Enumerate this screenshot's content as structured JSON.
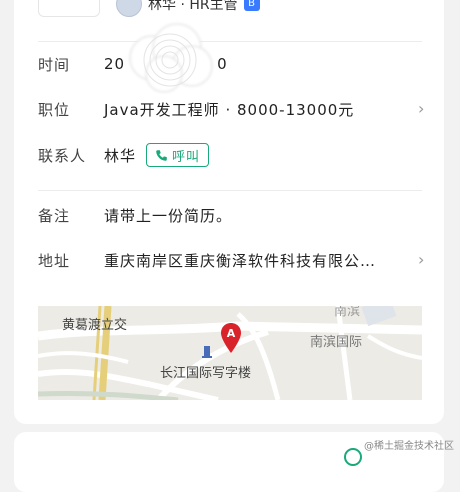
{
  "header": {
    "hr_name": "林华 · HR主管",
    "hr_badge": "B"
  },
  "details": {
    "time": {
      "label": "时间",
      "value_prefix": "20",
      "value_suffix": "0"
    },
    "position": {
      "label": "职位",
      "value": "Java开发工程师 · 8000-13000元"
    },
    "contact": {
      "label": "联系人",
      "value": "林华",
      "call_label": "呼叫"
    },
    "note": {
      "label": "备注",
      "value": "请带上一份简历。"
    },
    "address": {
      "label": "地址",
      "value": "重庆南岸区重庆衡泽软件科技有限公…"
    }
  },
  "map": {
    "labels": {
      "top_left": "黄葛渡立交",
      "right": "南滨国际",
      "building": "长江国际写字楼",
      "top_right": "南滨",
      "marker": "A"
    }
  },
  "footer": {
    "watermark": "@稀土掘金技术社区"
  },
  "colors": {
    "accent_green": "#1aa97a",
    "badge_blue": "#3a7afe",
    "marker_red": "#d8232a"
  }
}
